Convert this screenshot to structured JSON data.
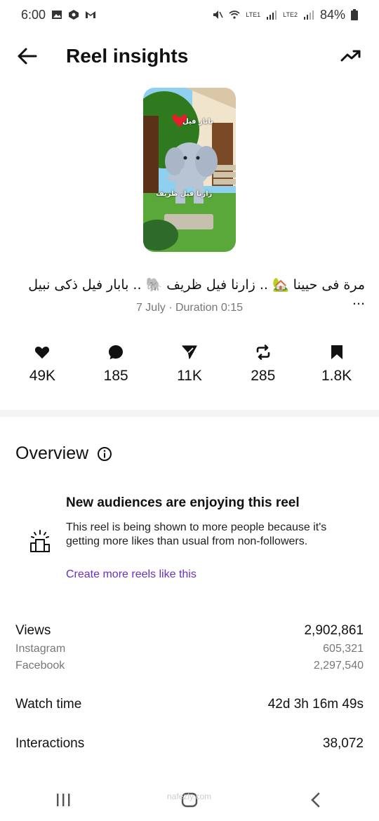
{
  "status": {
    "time": "6:00",
    "left_icons": [
      "gallery-icon",
      "hexagon-app-icon",
      "gmail-icon"
    ],
    "sim1": "LTE1",
    "sim2": "LTE2",
    "battery": "84%"
  },
  "header": {
    "title": "Reel insights"
  },
  "reel": {
    "caption": "مرة فى حيينا 🏡 .. زارنا فيل ظريف 🐘 .. بابار فيل ذكى نبيل ...",
    "meta": "7 July · Duration 0:15",
    "thumb_text_top": "بابار فيل",
    "thumb_text_mid": "زارنا فيل ظريف"
  },
  "stats": [
    {
      "icon": "heart-icon",
      "value": "49K"
    },
    {
      "icon": "comment-icon",
      "value": "185"
    },
    {
      "icon": "share-icon",
      "value": "11K"
    },
    {
      "icon": "repost-icon",
      "value": "285"
    },
    {
      "icon": "bookmark-icon",
      "value": "1.8K"
    }
  ],
  "overview": {
    "title": "Overview",
    "audience_title": "New audiences are enjoying this reel",
    "audience_body": "This reel is being shown to more people because it's getting more likes than usual from non-followers.",
    "audience_link": "Create more reels like this"
  },
  "metrics": {
    "views_label": "Views",
    "views_value": "2,902,861",
    "instagram_label": "Instagram",
    "instagram_value": "605,321",
    "facebook_label": "Facebook",
    "facebook_value": "2,297,540",
    "watch_label": "Watch time",
    "watch_value": "42d 3h 16m 49s",
    "interactions_label": "Interactions",
    "interactions_value": "38,072"
  },
  "watermark": "nafezly.com",
  "colors": {
    "link": "#6b2fc1",
    "muted": "#777777"
  }
}
